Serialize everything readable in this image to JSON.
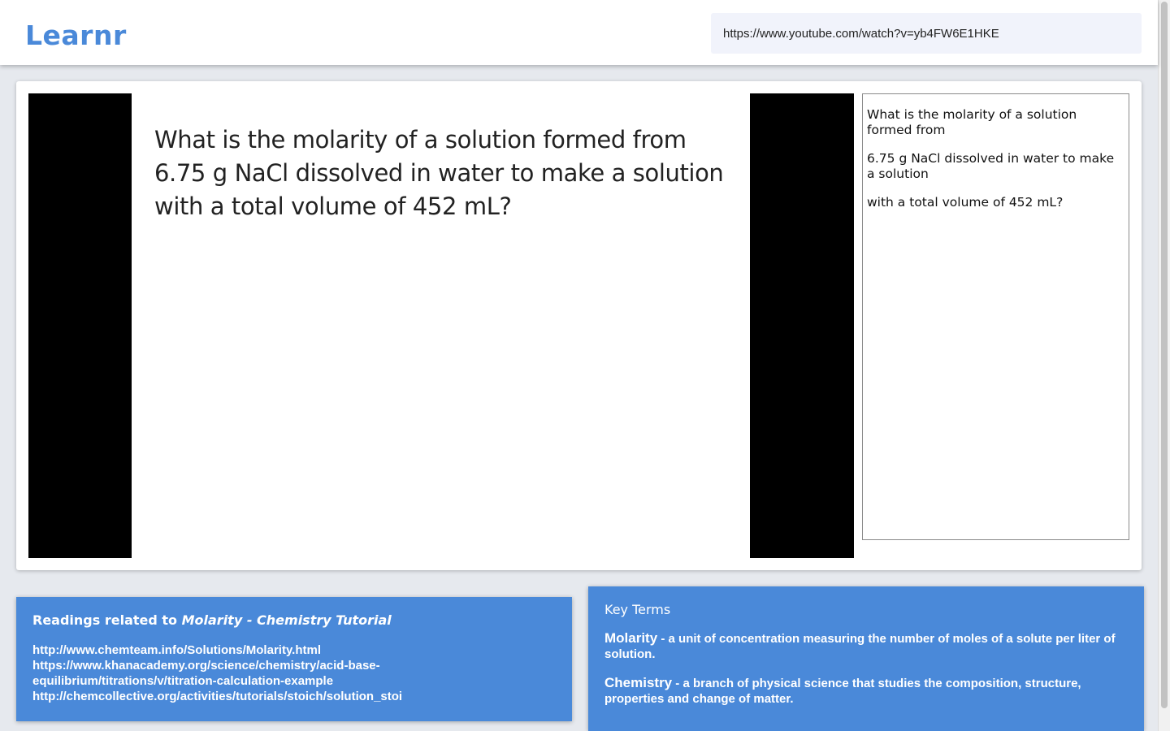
{
  "header": {
    "logo": "Learnr",
    "url_value": "https://www.youtube.com/watch?v=yb4FW6E1HKE"
  },
  "video": {
    "slide_text": "What is the molarity of a solution formed from 6.75 g NaCl dissolved in water to make a solution with a total volume of 452 mL?"
  },
  "transcript": {
    "lines": [
      "What is the molarity of a solution formed from",
      "6.75 g NaCl dissolved in water to make a solution",
      "with a total volume of 452 mL?"
    ]
  },
  "readings": {
    "title_prefix": "Readings related to ",
    "title_topic": "Molarity - Chemistry Tutorial",
    "links": [
      "http://www.chemteam.info/Solutions/Molarity.html",
      "https://www.khanacademy.org/science/chemistry/acid-base-equilibrium/titrations/v/titration-calculation-example",
      "http://chemcollective.org/activities/tutorials/stoich/solution_stoi"
    ]
  },
  "key_terms": {
    "title": "Key Terms",
    "terms": [
      {
        "word": "Molarity",
        "definition": " - a unit of concentration measuring the number of moles of a solute per liter of solution."
      },
      {
        "word": "Chemistry",
        "definition": " - a branch of physical science that studies the composition, structure, properties and change of matter."
      }
    ]
  },
  "colors": {
    "accent": "#4a89d9",
    "background": "#e6e9ee",
    "input_background": "#f1f3fb"
  }
}
